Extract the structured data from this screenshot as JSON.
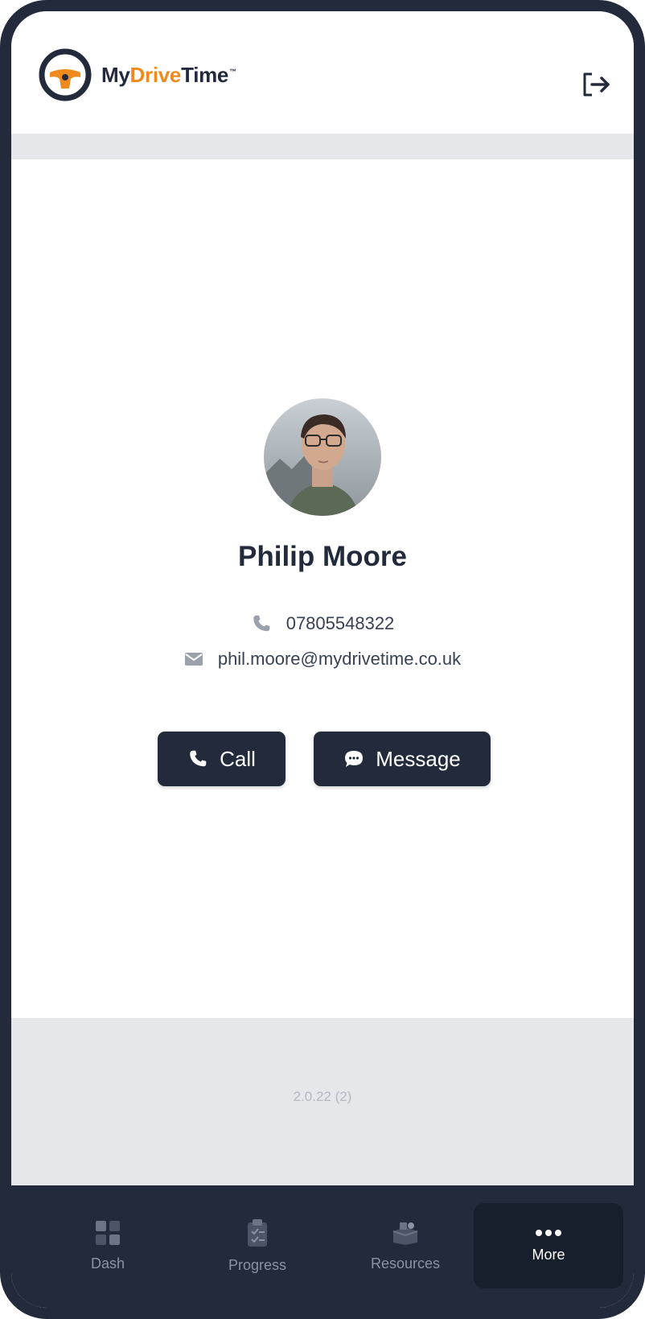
{
  "app": {
    "logo": {
      "part1": "My",
      "part2": "Drive",
      "part3": "Time",
      "trademark": "™"
    },
    "logout_icon": "logout-icon"
  },
  "profile": {
    "name": "Philip Moore",
    "phone": "07805548322",
    "email": "phil.moore@mydrivetime.co.uk",
    "avatar": "profile-photo"
  },
  "actions": {
    "call_label": "Call",
    "message_label": "Message"
  },
  "version": "2.0.22 (2)",
  "tabs": [
    {
      "label": "Dash",
      "icon": "grid-icon",
      "active": false
    },
    {
      "label": "Progress",
      "icon": "clipboard-icon",
      "active": false
    },
    {
      "label": "Resources",
      "icon": "resources-icon",
      "active": false
    },
    {
      "label": "More",
      "icon": "more-dots-icon",
      "active": true
    }
  ],
  "colors": {
    "primary": "#222a3b",
    "accent": "#ee8a1e",
    "surface_gray": "#e5e7eb"
  }
}
